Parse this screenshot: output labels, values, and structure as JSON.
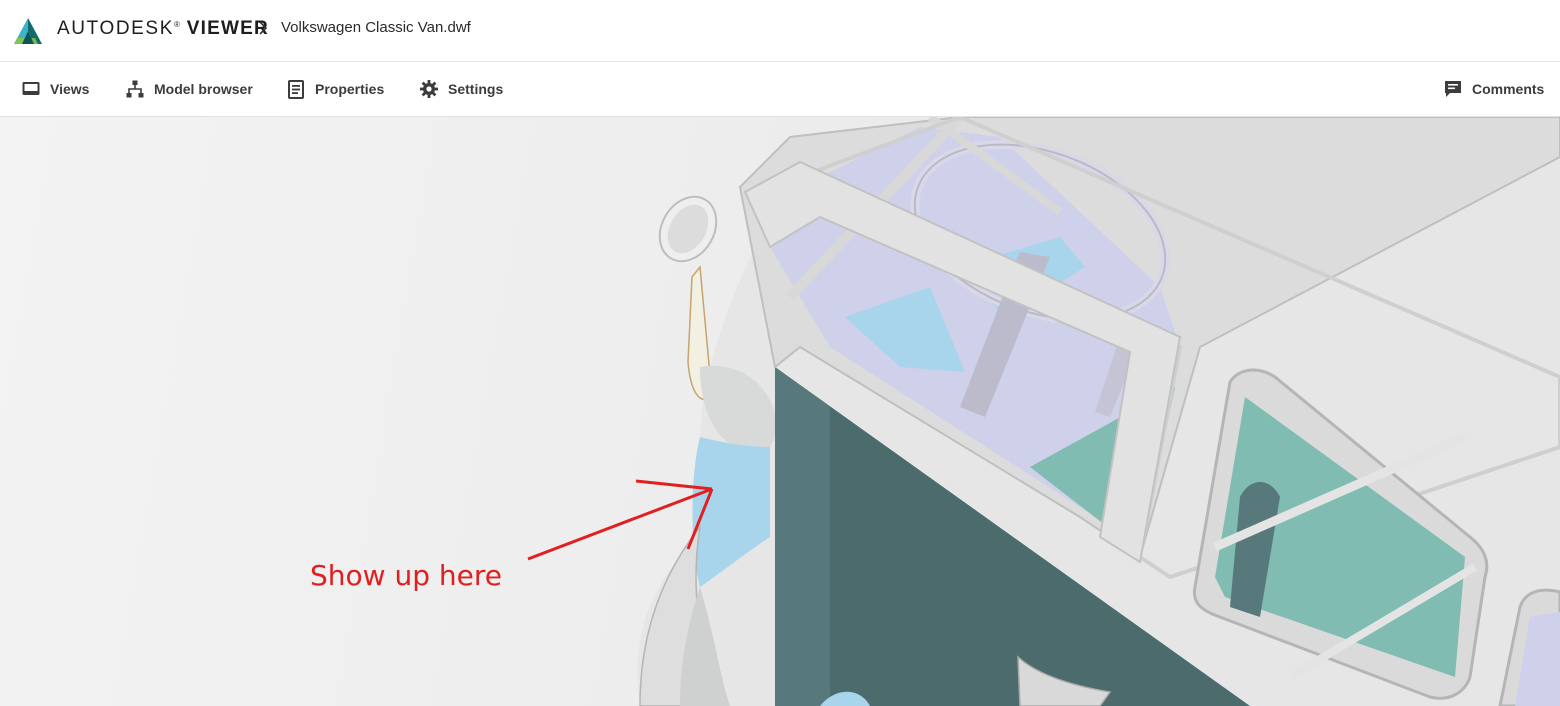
{
  "header": {
    "brand_name": "AUTODESK",
    "brand_registered": "®",
    "product_name": "VIEWER",
    "file_name": "Volkswagen Classic Van.dwf"
  },
  "toolbar": {
    "items": [
      {
        "label": "Views",
        "icon": "views-icon"
      },
      {
        "label": "Model browser",
        "icon": "model-browser-icon"
      },
      {
        "label": "Properties",
        "icon": "properties-icon"
      },
      {
        "label": "Settings",
        "icon": "gear-icon"
      }
    ],
    "comments": {
      "label": "Comments",
      "icon": "comments-icon"
    }
  },
  "viewport": {
    "annotation_text": "Show up here",
    "annotation_color": "#e02020"
  },
  "colors": {
    "logo_dark": "#0f6b6e",
    "logo_light": "#3bb3c8",
    "logo_accent": "#8cc63f",
    "van_panel": "#4c6b6d",
    "van_frame": "#d9d9d9",
    "glass_blue": "#a8d4ec",
    "glass_teal": "#80bcb2",
    "interior_lavender": "#cfd0ea"
  }
}
